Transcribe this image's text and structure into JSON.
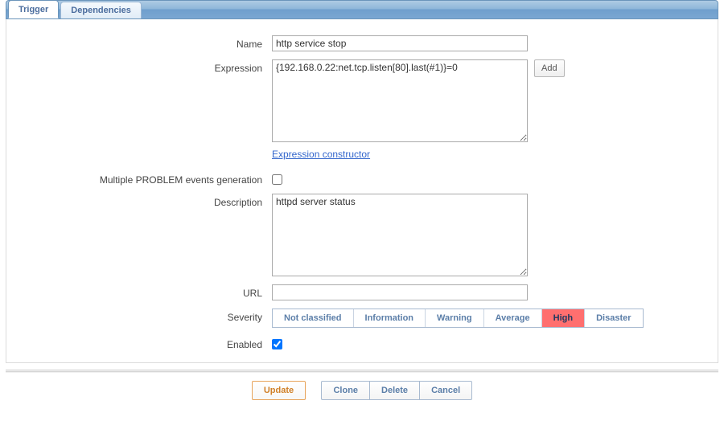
{
  "tabs": {
    "trigger": "Trigger",
    "dependencies": "Dependencies"
  },
  "labels": {
    "name": "Name",
    "expression": "Expression",
    "multiple_problem": "Multiple PROBLEM events generation",
    "description": "Description",
    "url": "URL",
    "severity": "Severity",
    "enabled": "Enabled"
  },
  "fields": {
    "name": "http service stop",
    "expression": "{192.168.0.22:net.tcp.listen[80].last(#1)}=0",
    "description": "httpd server status",
    "url": ""
  },
  "buttons": {
    "add": "Add",
    "update": "Update",
    "clone": "Clone",
    "delete": "Delete",
    "cancel": "Cancel"
  },
  "links": {
    "expression_constructor": "Expression constructor"
  },
  "severity_options": [
    "Not classified",
    "Information",
    "Warning",
    "Average",
    "High",
    "Disaster"
  ],
  "severity_selected": "High",
  "checkboxes": {
    "multiple_problem": false,
    "enabled": true
  }
}
